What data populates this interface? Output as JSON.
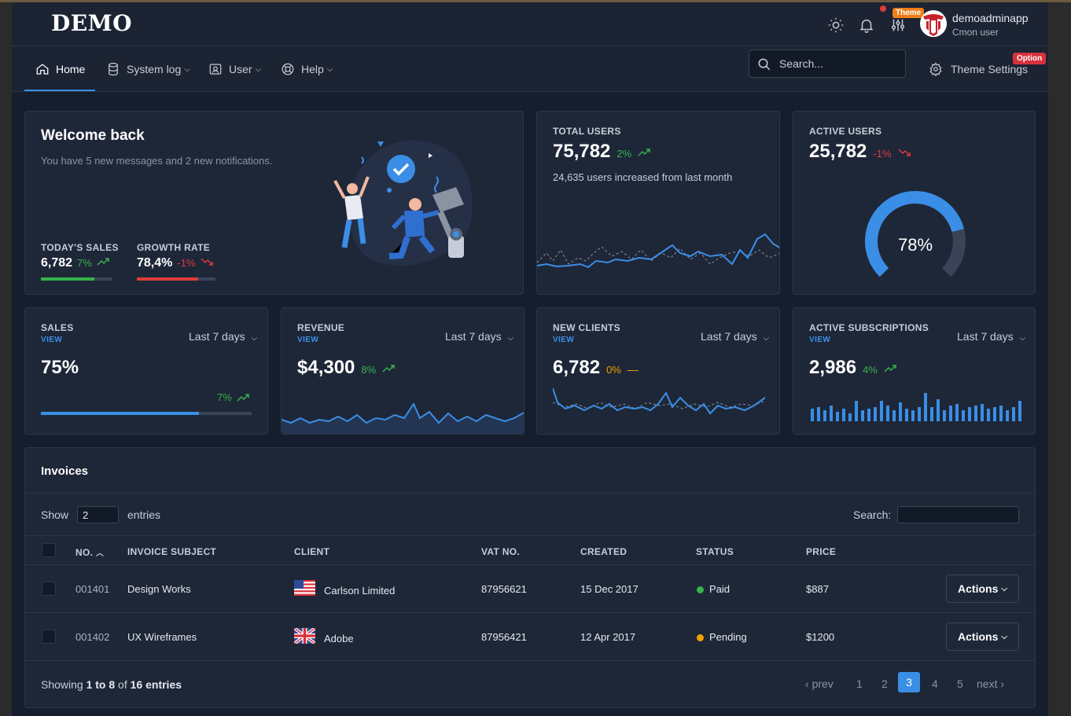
{
  "app": {
    "logo": "DEMO"
  },
  "header": {
    "theme_badge": "Theme",
    "user_name": "demoadminapp",
    "user_role": "Cmon user"
  },
  "nav": {
    "items": [
      {
        "label": "Home",
        "icon": "home-icon"
      },
      {
        "label": "System log",
        "icon": "database-icon"
      },
      {
        "label": "User",
        "icon": "user-card-icon"
      },
      {
        "label": "Help",
        "icon": "lifebuoy-icon"
      }
    ],
    "search_placeholder": "Search...",
    "theme_settings": "Theme Settings",
    "option_badge": "Option"
  },
  "welcome": {
    "title": "Welcome back",
    "subtitle": "You have 5 new messages and 2 new notifications.",
    "today_sales_label": "TODAY'S SALES",
    "today_sales_value": "6,782",
    "today_sales_change": "7%",
    "today_sales_progress": 0.75,
    "growth_label": "GROWTH RATE",
    "growth_value": "78,4%",
    "growth_change": "-1%",
    "growth_progress": 0.78
  },
  "total_users": {
    "label": "TOTAL USERS",
    "value": "75,782",
    "change": "2%",
    "note": "24,635 users increased from last month"
  },
  "active_users": {
    "label": "ACTIVE USERS",
    "value": "25,782",
    "change": "-1%",
    "gauge_percent": 78,
    "gauge_label": "78%"
  },
  "stats": {
    "range_label": "Last 7 days",
    "view_label": "VIEW",
    "sales": {
      "label": "SALES",
      "value": "75%",
      "change": "7%",
      "progress": 0.75
    },
    "revenue": {
      "label": "REVENUE",
      "value": "$4,300",
      "change": "8%"
    },
    "new_clients": {
      "label": "NEW CLIENTS",
      "value": "6,782",
      "change": "0%"
    },
    "subscriptions": {
      "label": "ACTIVE SUBSCRIPTIONS",
      "value": "2,986",
      "change": "4%"
    }
  },
  "invoices": {
    "title": "Invoices",
    "show_label": "Show",
    "entries_label": "entries",
    "show_value": "2",
    "search_label": "Search:",
    "columns": [
      "NO.",
      "INVOICE SUBJECT",
      "CLIENT",
      "VAT NO.",
      "CREATED",
      "STATUS",
      "PRICE"
    ],
    "rows": [
      {
        "no": "001401",
        "subject": "Design Works",
        "client": "Carlson Limited",
        "flag": "us-flag-icon",
        "vat": "87956621",
        "created": "15 Dec 2017",
        "status": "Paid",
        "status_color": "#37b24d",
        "price": "$887"
      },
      {
        "no": "001402",
        "subject": "UX Wireframes",
        "client": "Adobe",
        "flag": "uk-flag-icon",
        "vat": "87956421",
        "created": "12 Apr 2017",
        "status": "Pending",
        "status_color": "#f59f00",
        "price": "$1200"
      }
    ],
    "actions_label": "Actions",
    "footer_prefix": "Showing ",
    "footer_range": "1 to 8",
    "footer_mid": " of ",
    "footer_total": "16 entries",
    "pager": {
      "prev": "prev",
      "pages": [
        "1",
        "2",
        "3",
        "4",
        "5"
      ],
      "active": "3",
      "next": "next"
    }
  },
  "colors": {
    "accent": "#3a8ee6",
    "positive": "#37b24d",
    "negative": "#e03b3b",
    "warning": "#f59f00"
  }
}
